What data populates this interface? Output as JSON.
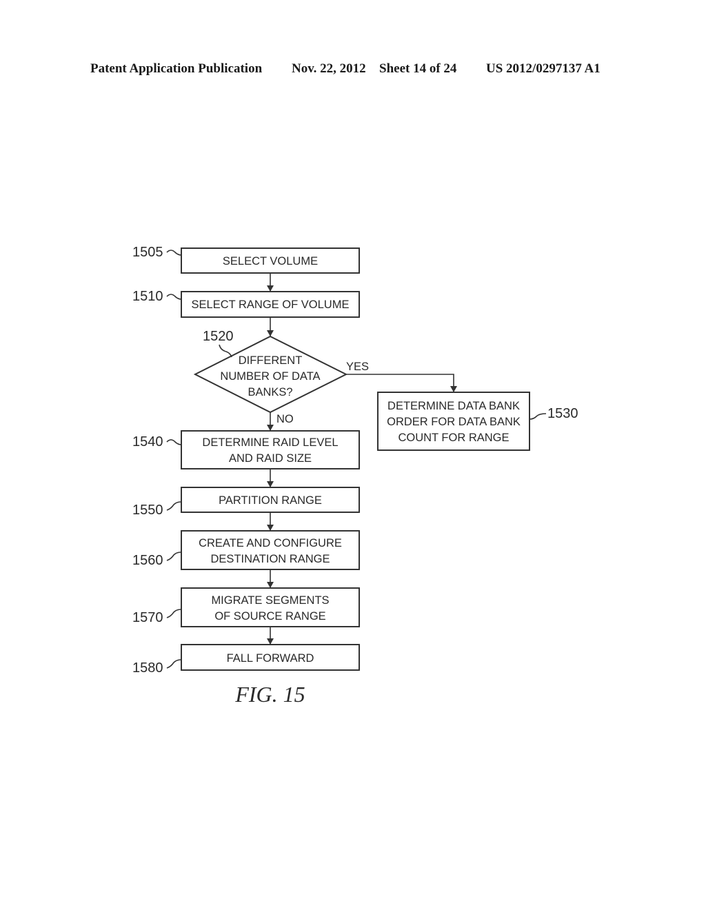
{
  "header": {
    "publication": "Patent Application Publication",
    "date": "Nov. 22, 2012",
    "sheet": "Sheet 14 of 24",
    "number": "US 2012/0297137 A1"
  },
  "figure_label": "FIG. 15",
  "steps": {
    "s1505": {
      "ref": "1505",
      "lines": [
        "SELECT VOLUME"
      ]
    },
    "s1510": {
      "ref": "1510",
      "lines": [
        "SELECT RANGE OF VOLUME"
      ]
    },
    "s1520": {
      "ref": "1520",
      "lines": [
        "DIFFERENT",
        "NUMBER OF DATA",
        "BANKS?"
      ]
    },
    "s1530": {
      "ref": "1530",
      "lines": [
        "DETERMINE DATA BANK",
        "ORDER FOR DATA BANK",
        "COUNT FOR RANGE"
      ]
    },
    "s1540": {
      "ref": "1540",
      "lines": [
        "DETERMINE RAID LEVEL",
        "AND RAID SIZE"
      ]
    },
    "s1550": {
      "ref": "1550",
      "lines": [
        "PARTITION RANGE"
      ]
    },
    "s1560": {
      "ref": "1560",
      "lines": [
        "CREATE AND CONFIGURE",
        "DESTINATION RANGE"
      ]
    },
    "s1570": {
      "ref": "1570",
      "lines": [
        "MIGRATE SEGMENTS",
        "OF SOURCE RANGE"
      ]
    },
    "s1580": {
      "ref": "1580",
      "lines": [
        "FALL FORWARD"
      ]
    }
  },
  "branches": {
    "yes": "YES",
    "no": "NO"
  }
}
